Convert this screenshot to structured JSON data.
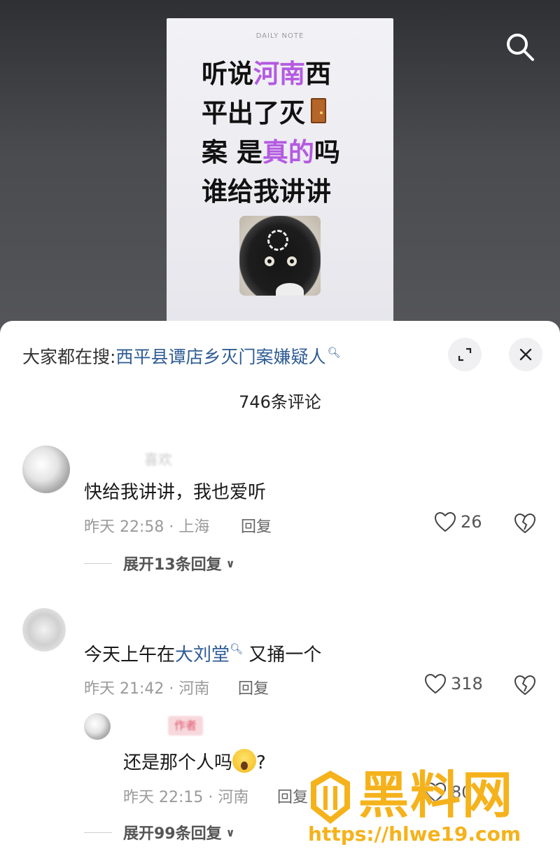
{
  "video": {
    "note_header": "DAILY NOTE",
    "lines": [
      {
        "pre": "听说",
        "hl": "河南",
        "post": "西"
      },
      {
        "pre": "平出了灭",
        "hl": "",
        "post": ""
      },
      {
        "pre": "案 是",
        "hl": "真的",
        "post": "吗"
      },
      {
        "pre": "谁给我讲讲",
        "hl": "",
        "post": ""
      }
    ],
    "highlight_color": "#b45ae0"
  },
  "sheet": {
    "trend_label": "大家都在搜:",
    "trend_query": "西平县谭店乡灭门案嫌疑人",
    "comment_count": "746条评论"
  },
  "comments": [
    {
      "username": "喜欢",
      "text": "快给我讲讲，我也爱听",
      "meta": "昨天 22:58 · 上海",
      "reply_label": "回复",
      "likes": "26",
      "expand": "展开13条回复"
    },
    {
      "username": "",
      "text_pre": "今天上午在",
      "text_link": "大刘堂",
      "text_post": " 又捅一个",
      "meta": "昨天 21:42 · 河南",
      "reply_label": "回复",
      "likes": "318",
      "reply": {
        "author_tag": "作者",
        "text_pre": "还是那个人吗",
        "text_post": "?",
        "meta": "昨天 22:15 · 河南",
        "reply_label": "回复",
        "likes": "80"
      },
      "expand": "展开99条回复"
    }
  ],
  "watermark": {
    "title": "黑料网",
    "url": "https://hlwe19.com",
    "color": "#f5b21b"
  }
}
